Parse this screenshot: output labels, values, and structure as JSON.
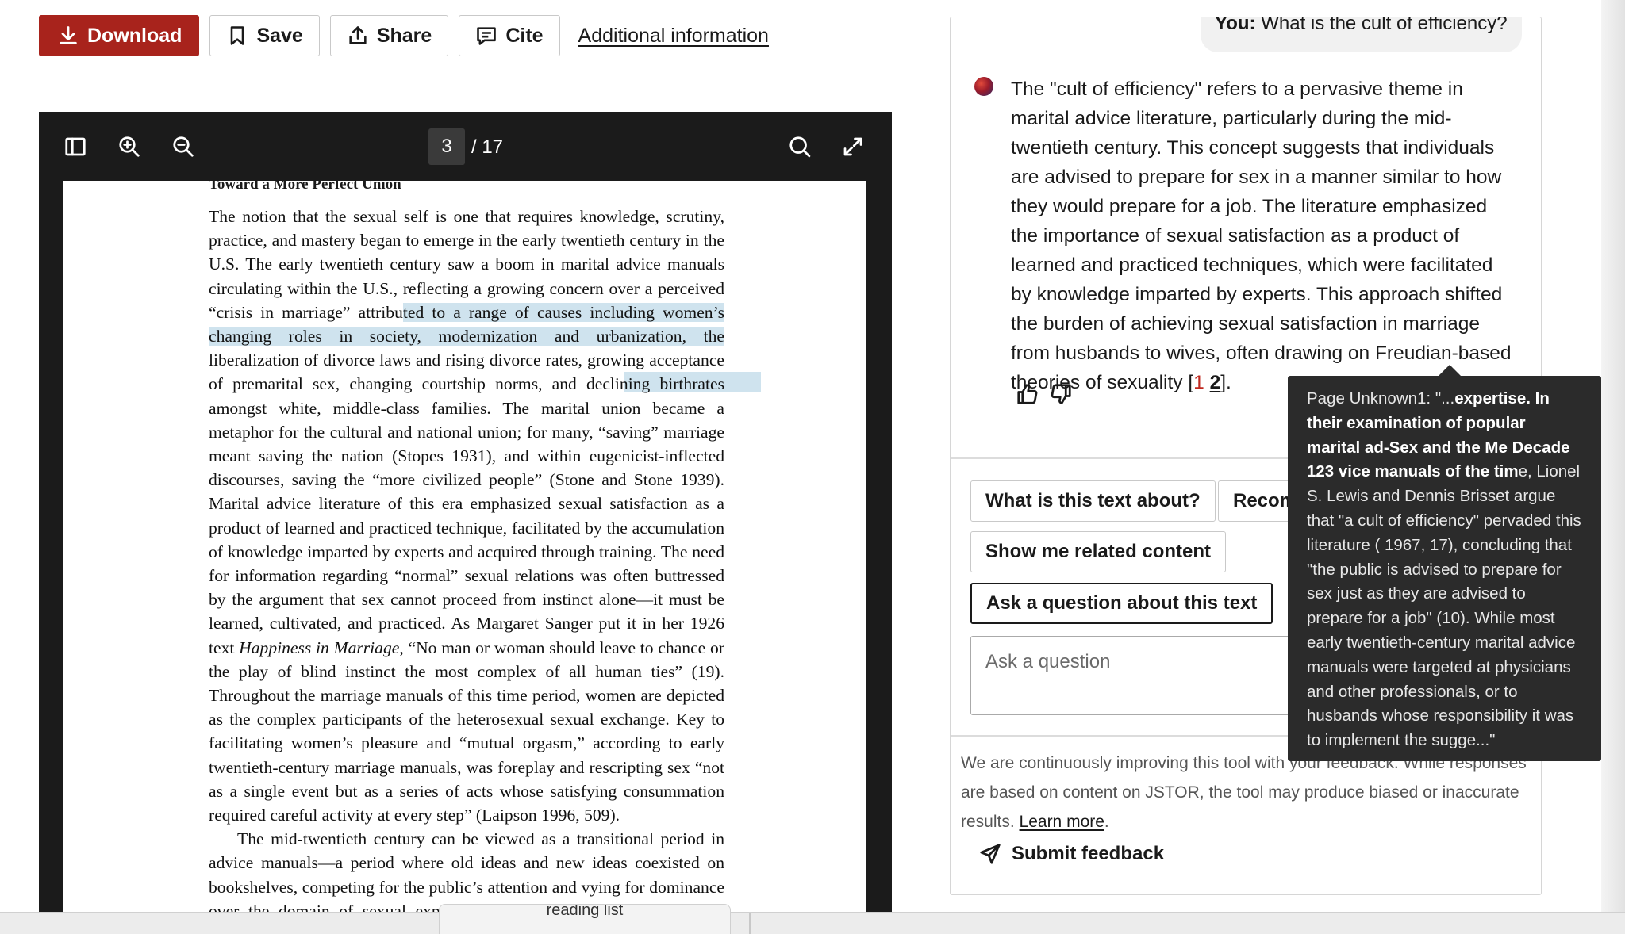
{
  "toolbar": {
    "download_label": "Download",
    "save_label": "Save",
    "share_label": "Share",
    "cite_label": "Cite",
    "additional_info_label": "Additional information"
  },
  "viewer": {
    "current_page": "3",
    "total_pages": "/ 17",
    "running_head": "Toward a More Perfect Union",
    "paragraph1_before_highlight": "The notion that the sexual self is one that requires knowledge, scrutiny, practice, and mastery began to emerge in the early twentieth century in the U.S. The early twentieth century saw a boom in marital advice manuals circulating within the U.S., reflecting a growing concern over a perceived “crisis in marriage” attribu",
    "paragraph1_highlight": "ted to a range of causes including women’s changing roles in society, modernization and urbanization, the",
    "paragraph1_after_highlight": " liberalization of divorce laws and rising divorce rates, growing acceptance of premarital sex, changing courtship norms, and declining birthrates amongst white, middle-class families. The marital union became a metaphor for the cultural and national union; for many, “saving” marriage meant saving the nation (Stopes 1931), and within eugenicist-inflected discourses, saving the “more civilized people” (Stone and Stone 1939). Marital advice literature of this era emphasized sexual satisfaction as a product of learned and practiced technique, facilitated by the accumulation of knowledge imparted by experts and acquired through training. The need for information regarding “normal” sexual relations was often buttressed by the argument that sex cannot proceed from instinct alone—it must be learned, cultivated, and practiced. As Margaret Sanger put it in her 1926 text ",
    "paragraph1_book_title": "Happiness in Marriage",
    "paragraph1_end": ", “No man or woman should leave to chance or the play of blind instinct the most complex of all human ties” (19). Throughout the marriage manuals of this time period, women are depicted as the complex participants of the heterosexual sexual exchange. Key to facilitating women’s pleasure and “mutual orgasm,” according to early twentieth-century marriage manuals, was foreplay and rescripting sex “not as a single event but as a series of acts whose satisfying consummation required careful activity at every step” (Laipson 1996, 509).",
    "paragraph2": "The mid-twentieth century can be viewed as a transitional period in advice manuals—a period where old ideas and new ideas coexisted on bookshelves, competing for the public’s attention and vying for dominance over the domain of sexual expertise. In their examination of popular marital ad-"
  },
  "chat": {
    "you_label": "You:",
    "you_question": " What is the cult of efficiency?",
    "answer_text": "The \"cult of efficiency\" refers to a pervasive theme in marital advice literature, particularly during the mid-twentieth century. This concept suggests that individuals are advised to prepare for sex in a manner similar to how they would prepare for a job. The literature emphasized the importance of sexual satisfaction as a product of learned and practiced techniques, which were facilitated by knowledge imparted by experts. This approach shifted the burden of achieving sexual satisfaction in marriage from husbands to wives, often drawing on Freudian-based theories of sexuality [",
    "cite_1": "1",
    "cite_2": "2",
    "answer_end": "].",
    "chip_about": "What is this text about?",
    "chip_recommend": "Recommend topics",
    "chip_related": "Show me related content",
    "chip_ask": "Ask a question about this text",
    "ask_placeholder": "Ask a question",
    "disclaimer": "We are continuously improving this tool with your feedback. While responses are based on content on JSTOR, the tool may produce biased or inaccurate results. ",
    "learn_more": "Learn more",
    "disclaimer_end": ".",
    "submit_feedback": "Submit feedback"
  },
  "tooltip": {
    "prefix": "Page Unknown1: \"...",
    "bold_part": "expertise. In their examination of popular marital ad-Sex and the Me Decade 123 vice manuals of the tim",
    "rest": "e, Lionel S. Lewis and Dennis Brisset argue that \"a cult of efficiency\" pervaded this literature ( 1967, 17), concluding that \"the public is advised to prepare for sex just as they are advised to prepare for a job\" (10). While most early twentieth-century marital advice manuals were targeted at physicians and other professionals, or to husbands whose responsibility it was to implement the sugge...\""
  },
  "bottom": {
    "tab_label": "reading list"
  },
  "colors": {
    "primary_button": "#a8231c",
    "highlight": "#cfe3ee",
    "viewer_background": "#1b1b1b",
    "tooltip_background": "#2b2b2b"
  },
  "icons": [
    "download-icon",
    "bookmark-icon",
    "share-icon",
    "cite-icon",
    "sidebar-toggle-icon",
    "zoom-in-icon",
    "zoom-out-icon",
    "search-icon",
    "fullscreen-icon",
    "thumbs-up-icon",
    "thumbs-down-icon",
    "send-icon"
  ]
}
